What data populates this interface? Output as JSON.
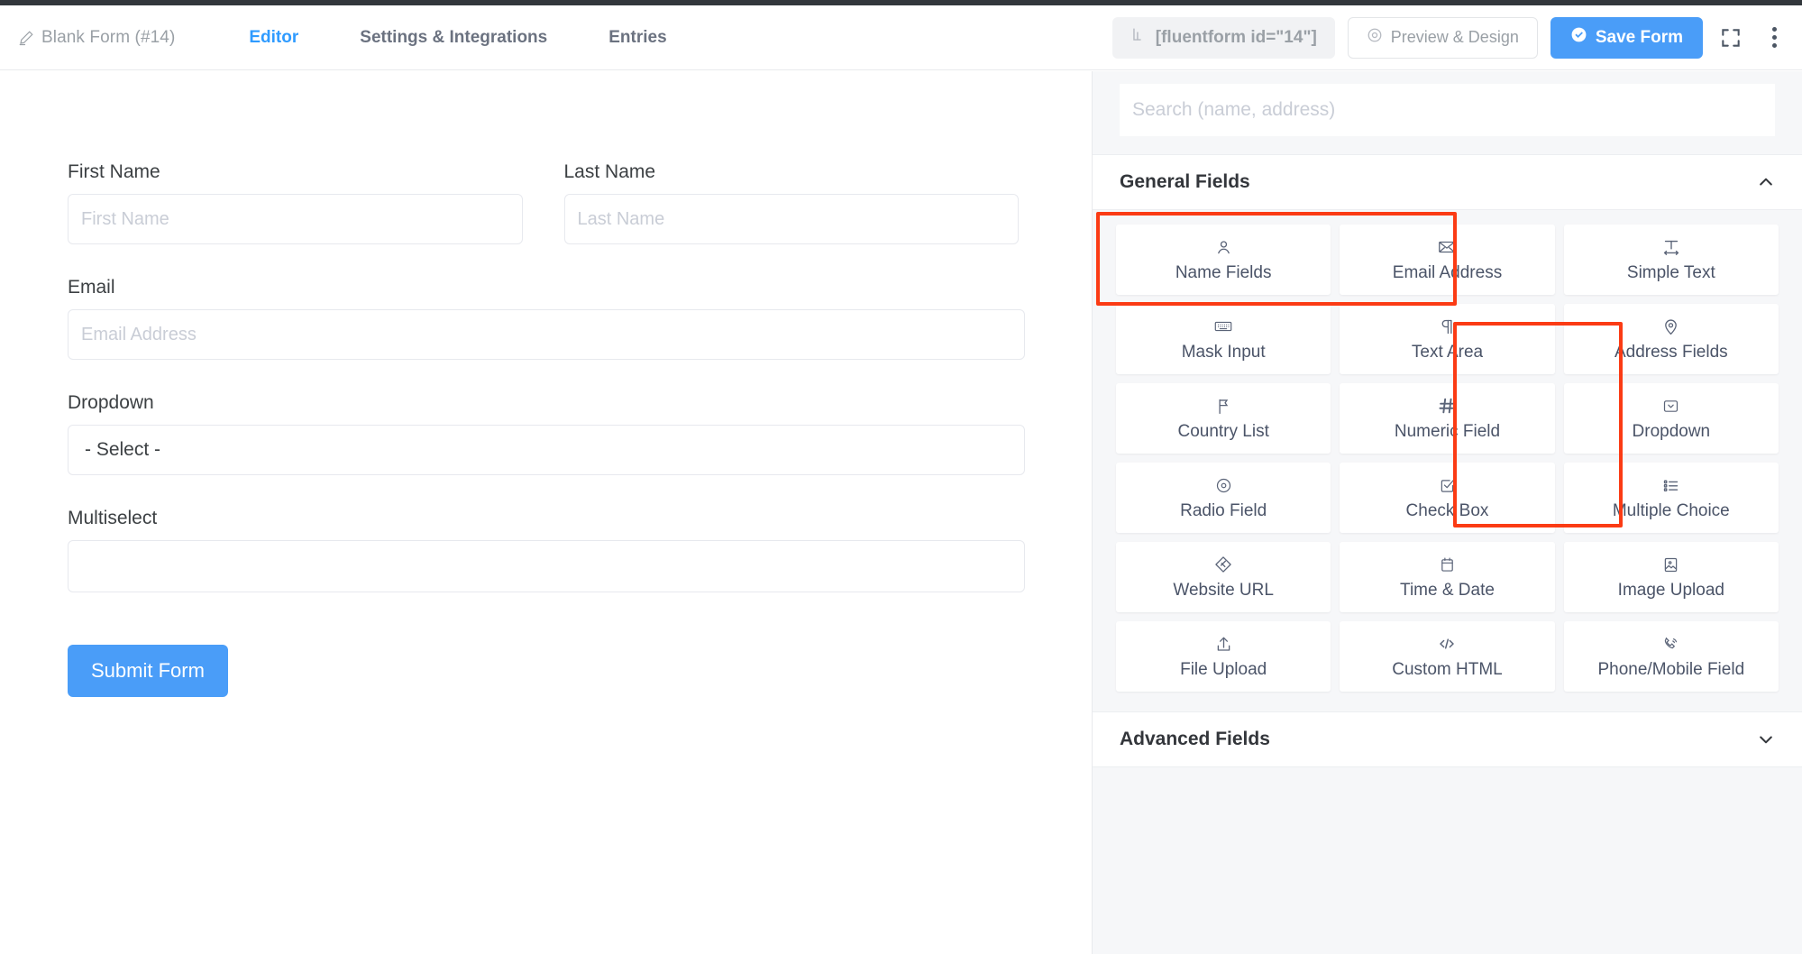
{
  "header": {
    "form_title": "Blank Form (#14)",
    "pencil_icon": "pencil-icon",
    "tabs": [
      {
        "label": "Editor",
        "active": true
      },
      {
        "label": "Settings & Integrations",
        "active": false
      },
      {
        "label": "Entries",
        "active": false
      }
    ],
    "shortcode": "[fluentform id=\"14\"]",
    "shortcode_icon": "shortcode-icon",
    "preview_label": "Preview & Design",
    "preview_icon": "eye-icon",
    "save_label": "Save Form",
    "save_icon": "check-circle-icon",
    "fullscreen_icon": "fullscreen-icon",
    "more_icon": "kebab-menu-icon",
    "accent_color": "#4a9df8",
    "tab_active_color": "#2f9bff",
    "topbar_color": "#32373c"
  },
  "form": {
    "fields": [
      {
        "label": "First Name",
        "placeholder": "First Name",
        "type": "text",
        "width": "half"
      },
      {
        "label": "Last Name",
        "placeholder": "Last Name",
        "type": "text",
        "width": "half"
      },
      {
        "label": "Email",
        "placeholder": "Email Address",
        "type": "text",
        "width": "full"
      },
      {
        "label": "Dropdown",
        "value": "- Select -",
        "type": "select",
        "width": "full"
      },
      {
        "label": "Multiselect",
        "value": "",
        "type": "multiselect",
        "width": "full"
      }
    ],
    "submit_label": "Submit Form"
  },
  "panel": {
    "search_placeholder": "Search (name, address)",
    "sections": [
      {
        "title": "General Fields",
        "expanded": true,
        "chevron": "chevron-up-icon"
      },
      {
        "title": "Advanced Fields",
        "expanded": false,
        "chevron": "chevron-down-icon"
      }
    ],
    "general_fields": [
      {
        "label": "Name Fields",
        "icon": "user-icon",
        "highlighted": true
      },
      {
        "label": "Email Address",
        "icon": "envelope-icon",
        "highlighted": true
      },
      {
        "label": "Simple Text",
        "icon": "text-width-icon",
        "highlighted": false
      },
      {
        "label": "Mask Input",
        "icon": "keyboard-icon",
        "highlighted": false
      },
      {
        "label": "Text Area",
        "icon": "paragraph-icon",
        "highlighted": false
      },
      {
        "label": "Address Fields",
        "icon": "map-pin-icon",
        "highlighted": false
      },
      {
        "label": "Country List",
        "icon": "flag-icon",
        "highlighted": false
      },
      {
        "label": "Numeric Field",
        "icon": "hash-icon",
        "highlighted": false
      },
      {
        "label": "Dropdown",
        "icon": "dropdown-box-icon",
        "highlighted": true
      },
      {
        "label": "Radio Field",
        "icon": "radio-circle-icon",
        "highlighted": false
      },
      {
        "label": "Check Box",
        "icon": "checkbox-icon",
        "highlighted": false
      },
      {
        "label": "Multiple Choice",
        "icon": "list-icon",
        "highlighted": true
      },
      {
        "label": "Website URL",
        "icon": "link-diamond-icon",
        "highlighted": false
      },
      {
        "label": "Time & Date",
        "icon": "calendar-icon",
        "highlighted": false
      },
      {
        "label": "Image Upload",
        "icon": "image-icon",
        "highlighted": false
      },
      {
        "label": "File Upload",
        "icon": "upload-icon",
        "highlighted": false
      },
      {
        "label": "Custom HTML",
        "icon": "code-icon",
        "highlighted": false
      },
      {
        "label": "Phone/Mobile Field",
        "icon": "phone-icon",
        "highlighted": false
      }
    ],
    "highlight_color": "#fb3b14"
  }
}
